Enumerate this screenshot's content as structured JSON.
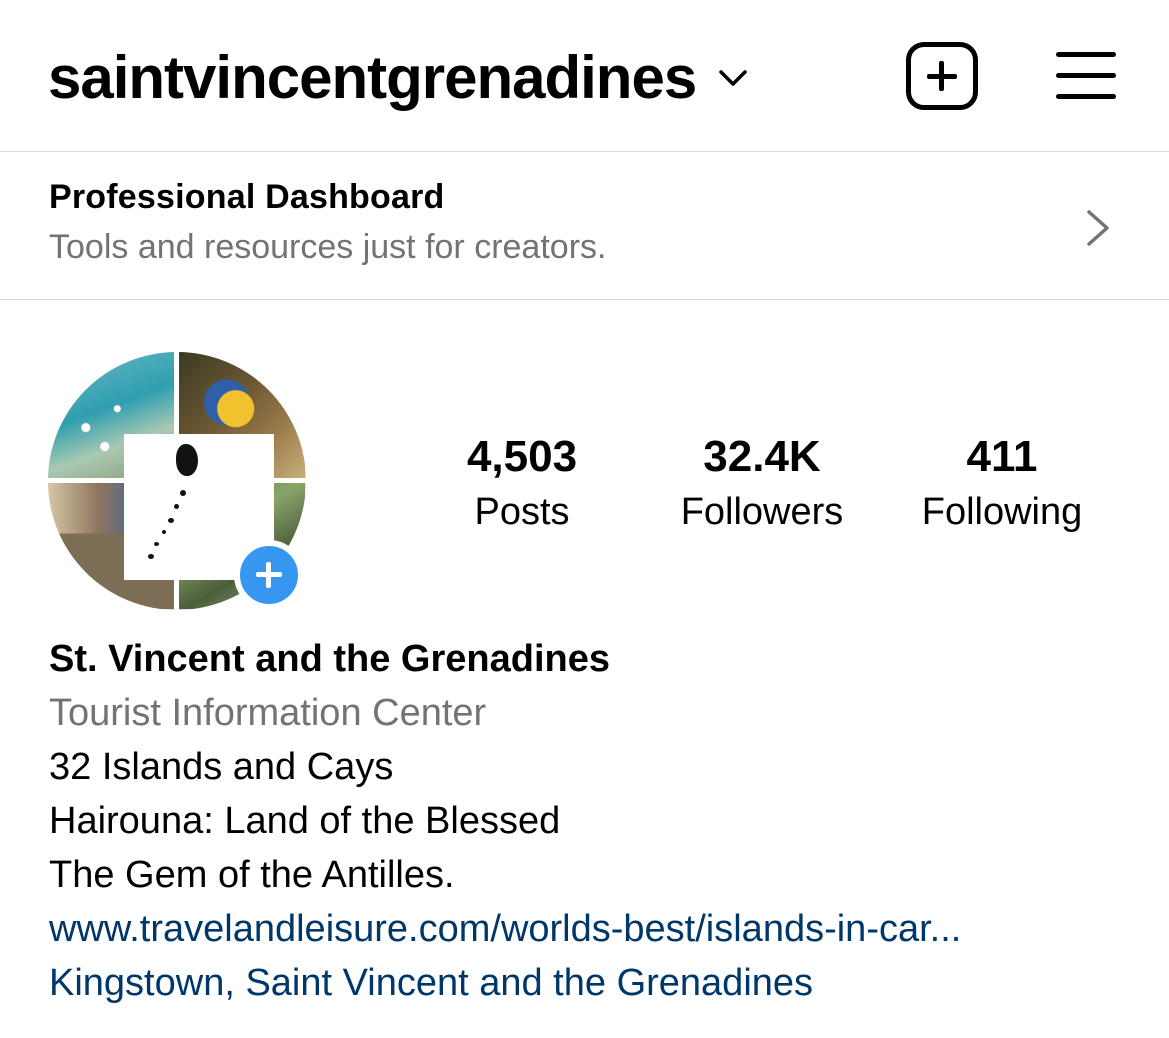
{
  "header": {
    "username": "saintvincentgrenadines",
    "icons": {
      "account_switch": "chevron-down-icon",
      "new_post": "plus-square-icon",
      "menu": "hamburger-menu-icon"
    }
  },
  "dashboard": {
    "title": "Professional Dashboard",
    "subtitle": "Tools and resources just for creators.",
    "icon": "chevron-right-icon"
  },
  "profile": {
    "avatar_icon": "profile-photo",
    "add_story_icon": "plus-icon",
    "add_story_color": "#3797f0",
    "stats": [
      {
        "value": "4,503",
        "label": "Posts"
      },
      {
        "value": "32.4K",
        "label": "Followers"
      },
      {
        "value": "411",
        "label": "Following"
      }
    ]
  },
  "bio": {
    "name": "St. Vincent and the Grenadines",
    "category": "Tourist Information Center",
    "lines": [
      "32 Islands and Cays",
      "Hairouna: Land of the Blessed",
      "The Gem of the Antilles."
    ],
    "link": "www.travelandleisure.com/worlds-best/islands-in-car...",
    "location": "Kingstown, Saint Vincent and the Grenadines",
    "link_color": "#00376b"
  }
}
